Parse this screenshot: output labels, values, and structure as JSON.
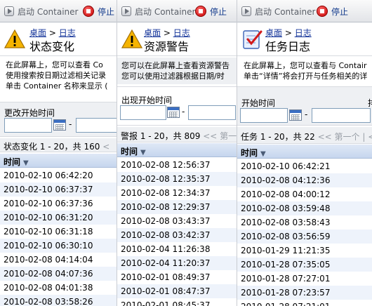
{
  "toolbar": {
    "start_label": "启动 Container",
    "stop_label": "停止"
  },
  "crumb_desktop": "桌面",
  "crumb_sep": " > ",
  "crumb_log": "日志",
  "panels": [
    {
      "title": "状态变化",
      "desc": [
        "在此屏幕上，您可以查看 Co",
        "使用搜索按日期过滤相关记录",
        "单击 Container 名称来显示 ("
      ],
      "filter_label": "更改开始时间",
      "pager": "状态变化 1 - 20，共 160",
      "pager_nav": "<",
      "col_header": "时间",
      "rows": [
        "2010-02-10 06:42:20",
        "2010-02-10 06:37:37",
        "2010-02-10 06:37:36",
        "2010-02-10 06:31:20",
        "2010-02-10 06:31:18",
        "2010-02-10 06:30:10",
        "2010-02-08 04:14:04",
        "2010-02-08 04:07:36",
        "2010-02-08 04:01:38",
        "2010-02-08 03:58:26"
      ]
    },
    {
      "title": "资源警告",
      "desc": [
        "您可以在此屏幕上查看资源警告",
        "您可以使用过滤器根据日期/时"
      ],
      "filter_label": "出现开始时间",
      "pager": "警报 1 - 20，共 809",
      "pager_nav": "<< 第一",
      "col_header": "时间",
      "rows": [
        "2010-02-08 12:56:37",
        "2010-02-08 12:35:37",
        "2010-02-08 12:34:37",
        "2010-02-08 12:29:37",
        "2010-02-08 03:43:37",
        "2010-02-08 03:42:37",
        "2010-02-04 11:26:38",
        "2010-02-04 11:20:37",
        "2010-02-01 08:49:37",
        "2010-02-01 08:47:37",
        "2010-02-01 08:45:37"
      ]
    },
    {
      "title": "任务日志",
      "desc": [
        "在此屏幕上，您可以查看与 Contair",
        "单击“详情”将会打开与任务相关的详"
      ],
      "filter_label": "开始时间",
      "filter_label2": "排",
      "pager": "任务 1 - 20，共 22",
      "pager_nav": "<< 第一个 | <",
      "col_header": "时间",
      "rows": [
        "2010-02-10 06:42:21",
        "2010-02-08 04:12:36",
        "2010-02-08 04:00:12",
        "2010-02-08 03:59:48",
        "2010-02-08 03:58:43",
        "2010-02-08 03:56:59",
        "2010-01-29 11:21:35",
        "2010-01-28 07:35:05",
        "2010-01-28 07:27:01",
        "2010-01-28 07:23:57",
        "2010-01-28 07:21:01"
      ]
    }
  ]
}
